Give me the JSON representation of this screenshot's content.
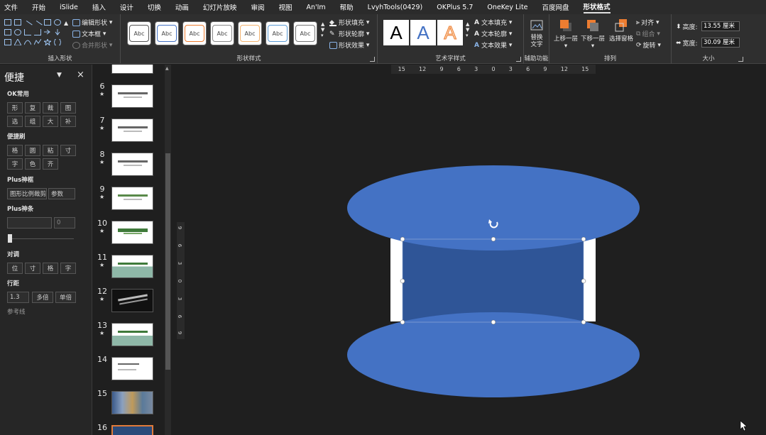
{
  "menu": [
    "文件",
    "开始",
    "iSlide",
    "插入",
    "设计",
    "切换",
    "动画",
    "幻灯片放映",
    "审阅",
    "视图",
    "An'Im",
    "帮助",
    "LvyhTools(0429)",
    "OKPlus 5.7",
    "OneKey Lite",
    "百度网盘",
    "形状格式"
  ],
  "active_tab": "形状格式",
  "ribbon": {
    "insert_shape": {
      "label": "插入形状",
      "edit_shape": "编辑形状",
      "text_box": "文本框",
      "merge_shapes": "合并形状"
    },
    "shape_styles": {
      "label": "形状样式",
      "sample": "Abc",
      "fill": "形状填充",
      "outline": "形状轮廓",
      "effects": "形状效果"
    },
    "wordart": {
      "label": "艺术字样式",
      "sample": "A",
      "text_fill": "文本填充",
      "text_outline": "文本轮廓",
      "text_effects": "文本效果"
    },
    "aux": {
      "label": "辅助功能",
      "alt_text": "替换文字"
    },
    "arrange": {
      "label": "排列",
      "bring_forward": "上移一层",
      "send_backward": "下移一层",
      "selection_pane": "选择窗格",
      "align": "对齐",
      "group": "组合",
      "rotate": "旋转"
    },
    "size": {
      "label": "大小",
      "height_label": "高度:",
      "height_value": "13.55 厘米",
      "width_label": "宽度:",
      "width_value": "30.09 厘米"
    }
  },
  "left_panel": {
    "title": "便捷",
    "sections": [
      {
        "title": "OK常用",
        "rows": [
          [
            "形",
            "复",
            "裁",
            "图"
          ],
          [
            "选",
            "组",
            "大",
            "补"
          ]
        ]
      },
      {
        "title": "便捷刷",
        "rows": [
          [
            "格",
            "圆",
            "粘",
            "寸"
          ],
          [
            "字",
            "色",
            "齐"
          ]
        ]
      }
    ],
    "plus_frame": {
      "title": "Plus神框",
      "btn1": "图形比例裁剪",
      "btn2": "参数"
    },
    "plus_bar": {
      "title": "Plus神条",
      "value": "0"
    },
    "align": {
      "title": "对调",
      "buttons": [
        "位",
        "寸",
        "格",
        "字"
      ]
    },
    "spacing": {
      "title": "行距",
      "value": "1.3",
      "btn1": "多倍",
      "btn2": "单倍"
    },
    "reference": "参考线"
  },
  "thumbnails": [
    "6",
    "7",
    "8",
    "9",
    "10",
    "11",
    "12",
    "13",
    "14",
    "15",
    "16"
  ],
  "ruler_h": [
    "15",
    "12",
    "9",
    "6",
    "3",
    "0",
    "3",
    "6",
    "9",
    "12",
    "15"
  ],
  "ruler_v": [
    "9",
    "6",
    "3",
    "0",
    "3",
    "6",
    "9"
  ],
  "colors": {
    "shape_blue": "#4472c4",
    "shape_dark": "#2f5597",
    "selection": "#ffffff",
    "bg": "#1f1f1f",
    "accent_orange": "#ed7d31"
  }
}
